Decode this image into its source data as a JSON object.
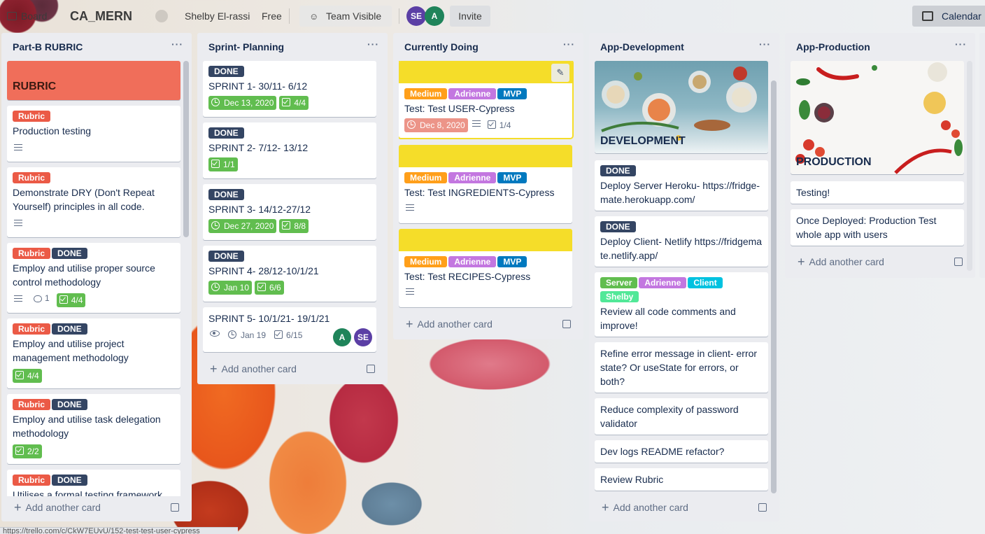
{
  "header": {
    "board_label": "Board",
    "board_title": "CA_MERN",
    "workspace_name": "Shelby El-rassi",
    "plan": "Free",
    "visibility": "Team Visible",
    "members": [
      "SE",
      "A"
    ],
    "invite": "Invite",
    "calendar": "Calendar"
  },
  "lists": [
    {
      "title": "Part-B RUBRIC",
      "cover_title": "RUBRIC",
      "cards": [
        {
          "labels": [
            "Rubric"
          ],
          "title": "Production testing"
        },
        {
          "labels": [
            "Rubric"
          ],
          "title": "Demonstrate DRY (Don't Repeat Yourself) principles in all code."
        },
        {
          "labels": [
            "Rubric",
            "DONE"
          ],
          "title": "Employ and utilise proper source control methodology",
          "comments": "1",
          "checklist": "4/4"
        },
        {
          "labels": [
            "Rubric",
            "DONE"
          ],
          "title": "Employ and utilise project management methodology",
          "checklist": "4/4"
        },
        {
          "labels": [
            "Rubric",
            "DONE"
          ],
          "title": "Employ and utilise task delegation methodology",
          "checklist": "2/2"
        },
        {
          "labels": [
            "Rubric",
            "DONE"
          ],
          "title": "Utilises a formal testing framework"
        }
      ],
      "add_card": "Add another card"
    },
    {
      "title": "Sprint- Planning",
      "cards": [
        {
          "labels": [
            "DONE"
          ],
          "title": "SPRINT 1- 30/11- 6/12",
          "due": "Dec 13, 2020",
          "checklist": "4/4"
        },
        {
          "labels": [
            "DONE"
          ],
          "title": "SPRINT 2- 7/12- 13/12",
          "checklist": "1/1"
        },
        {
          "labels": [
            "DONE"
          ],
          "title": "SPRINT 3- 14/12-27/12",
          "due": "Dec 27, 2020",
          "checklist": "8/8"
        },
        {
          "labels": [
            "DONE"
          ],
          "title": "SPRINT 4- 28/12-10/1/21",
          "due": "Jan 10",
          "checklist": "6/6"
        },
        {
          "title": "SPRINT 5- 10/1/21- 19/1/21",
          "due": "Jan 19",
          "checklist": "6/15",
          "members": [
            "A",
            "SE"
          ]
        }
      ],
      "add_card": "Add another card"
    },
    {
      "title": "Currently Doing",
      "cards": [
        {
          "labels": [
            "Medium",
            "Adrienne",
            "MVP"
          ],
          "title": "Test: Test USER-Cypress",
          "due": "Dec 8, 2020",
          "checklist": "1/4"
        },
        {
          "labels": [
            "Medium",
            "Adrienne",
            "MVP"
          ],
          "title": "Test: Test INGREDIENTS-Cypress"
        },
        {
          "labels": [
            "Medium",
            "Adrienne",
            "MVP"
          ],
          "title": "Test: Test RECIPES-Cypress"
        }
      ],
      "add_card": "Add another card"
    },
    {
      "title": "App-Development",
      "cover_title": "DEVELOPMENT",
      "cards": [
        {
          "labels": [
            "DONE"
          ],
          "title": "Deploy Server Heroku- https://fridge-mate.herokuapp.com/"
        },
        {
          "labels": [
            "DONE"
          ],
          "title": "Deploy Client- Netlify https://fridgemate.netlify.app/"
        },
        {
          "labels": [
            "Server",
            "Adrienne",
            "Client",
            "Shelby"
          ],
          "title": "Review all code comments and improve!"
        },
        {
          "title": "Refine error message in client- error state? Or useState for errors, or both?"
        },
        {
          "title": "Reduce complexity of password validator"
        },
        {
          "title": "Dev logs README refactor?"
        },
        {
          "title": "Review Rubric"
        }
      ],
      "add_card": "Add another card"
    },
    {
      "title": "App-Production",
      "cover_title": "PRODUCTION",
      "cards": [
        {
          "title": "Testing!"
        },
        {
          "title": "Once Deployed: Production Test whole app with users"
        }
      ],
      "add_card": "Add another card"
    }
  ],
  "status_url": "https://trello.com/c/CkW7EUvU/152-test-test-user-cypress",
  "colors": {
    "rubric_label": "#eb5a46",
    "done_label": "#344563",
    "medium_label": "#ff9f1a",
    "adrienne_label": "#c377e0",
    "mvp_label": "#0079bf",
    "server_label": "#61bd4f",
    "client_label": "#00c2e0",
    "shelby_label": "#51e898",
    "cover_red": "#f06e5a",
    "cover_yellow": "#f5dd29",
    "list_bg": "#ebecf0"
  },
  "icons": [
    "board-icon",
    "star-icon",
    "team-visible-icon",
    "calendar-icon",
    "more-icon",
    "description-icon",
    "comment-icon",
    "checklist-icon",
    "clock-icon",
    "watch-icon",
    "plus-icon",
    "template-icon",
    "pencil-icon"
  ]
}
